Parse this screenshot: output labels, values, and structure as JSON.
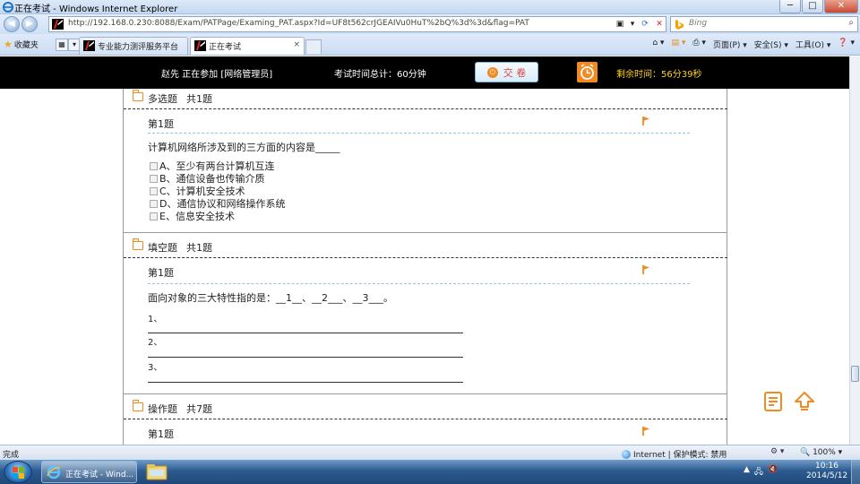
{
  "window": {
    "title": "正在考试 - Windows Internet Explorer",
    "min_glyph": "─",
    "max_glyph": "□",
    "close_glyph": "✕"
  },
  "address_bar": {
    "url": "http://192.168.0.230:8088/Exam/PATPage/Examing_PAT.aspx?Id=UF8t562crJGEAIVu0HuT%2bQ%3d%3d&flag=PAT",
    "search_placeholder": "Bing"
  },
  "toolbar": {
    "favorites_label": "收藏夹",
    "tabs": [
      {
        "label": "专业能力测评服务平台",
        "active": false
      },
      {
        "label": "正在考试",
        "active": true
      }
    ],
    "tab_close_glyph": "×",
    "commands": [
      "页面(P) ▾",
      "安全(S) ▾",
      "工具(O) ▾",
      "❓ ▾"
    ]
  },
  "exam_header": {
    "examinee_status": "赵先  正在参加  [网络管理员]",
    "total_time": "考试时间总计：60分钟",
    "submit_label": "交 卷",
    "remaining_time": "剩余时间：56分39秒"
  },
  "sections": {
    "multi": {
      "name": "多选题",
      "count": "共1题",
      "question_no": "第1题",
      "question_text": "计算机网络所涉及到的三方面的内容是_____",
      "options": [
        "A、至少有两台计算机互连",
        "B、通信设备也传输介质",
        "C、计算机安全技术",
        "D、通信协议和网络操作系统",
        "E、信息安全技术"
      ]
    },
    "fill": {
      "name": "填空题",
      "count": "共1题",
      "question_no": "第1题",
      "question_text": "面向对象的三大特性指的是：__1__、__2___、__3___。",
      "blanks": [
        "1、",
        "2、",
        "3、"
      ]
    },
    "operation": {
      "name": "操作题",
      "count": "共7题",
      "question_no": "第1题"
    }
  },
  "status_bar": {
    "status_text": "完成",
    "zone": "Internet | 保护模式: 禁用",
    "zoom": "🔍 100%  ▾"
  },
  "taskbar": {
    "ie_button_label": "正在考试 - Wind...",
    "time": "10:16",
    "date": "2014/5/12"
  },
  "colors": {
    "accent_orange": "#f08a21",
    "remaining_time_yellow": "#ffd21a",
    "submit_text_red": "#dd4444"
  }
}
